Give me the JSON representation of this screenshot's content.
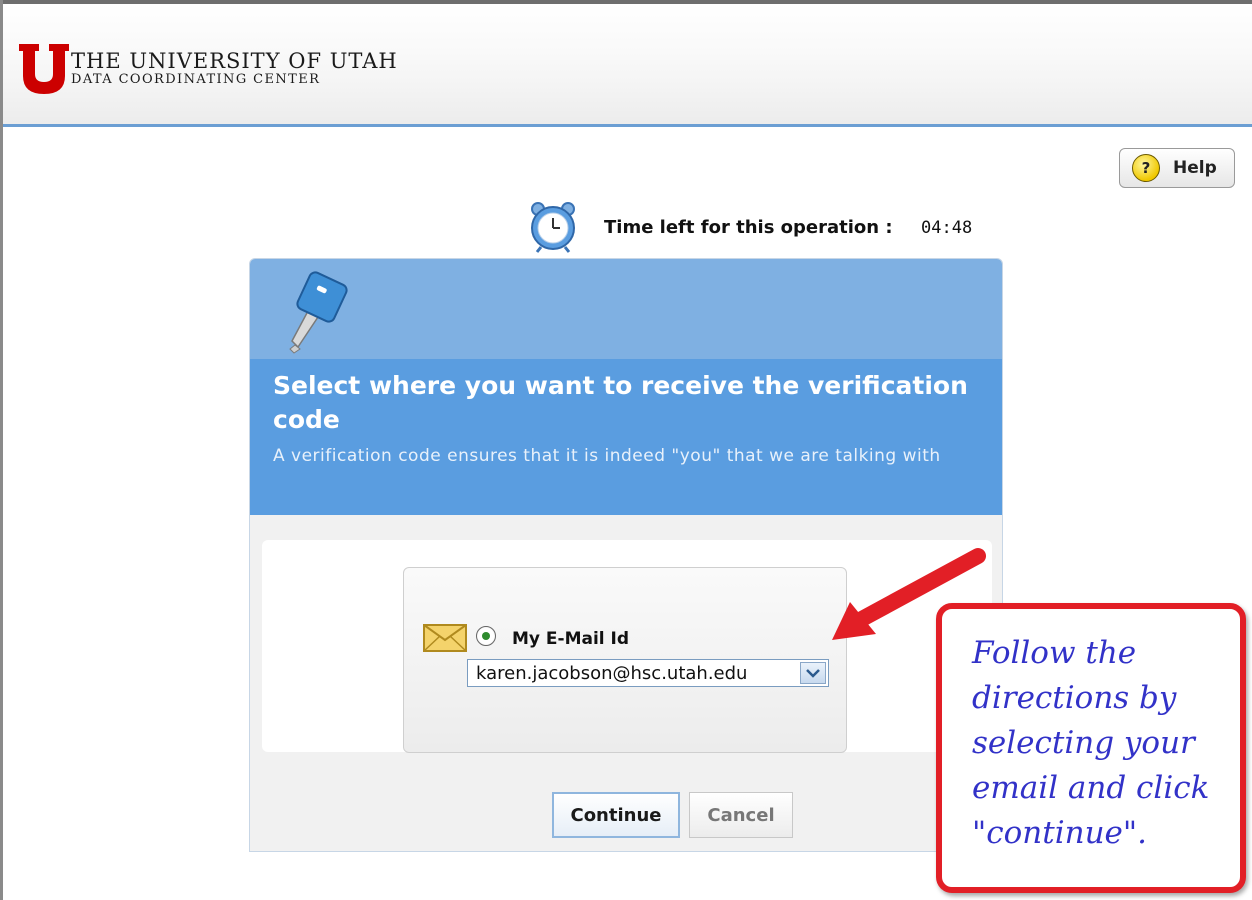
{
  "header": {
    "logo_line1": "THE UNIVERSITY OF UTAH",
    "logo_line2": "DATA COORDINATING CENTER",
    "brand_color": "#cc0000",
    "rule_color": "#6b9ed3"
  },
  "help": {
    "label": "Help",
    "icon": "question-icon"
  },
  "timer": {
    "label": "Time left for this operation :",
    "value": "04:48",
    "icon": "alarm-clock-icon"
  },
  "dialog": {
    "icon": "key-icon",
    "title": "Select where you want to receive the verification code",
    "subtitle": "A verification code ensures that it is indeed \"you\" that we are talking with",
    "header_color": "#5a9de0",
    "option": {
      "icon": "envelope-icon",
      "label": "My E-Mail Id",
      "selected": true,
      "email_selected": "karen.jacobson@hsc.utah.edu"
    },
    "continue_label": "Continue",
    "cancel_label": "Cancel"
  },
  "annotation": {
    "text": "Follow the directions by selecting your email and click \"continue\".",
    "color": "#e21f26",
    "text_color": "#3232c8"
  }
}
